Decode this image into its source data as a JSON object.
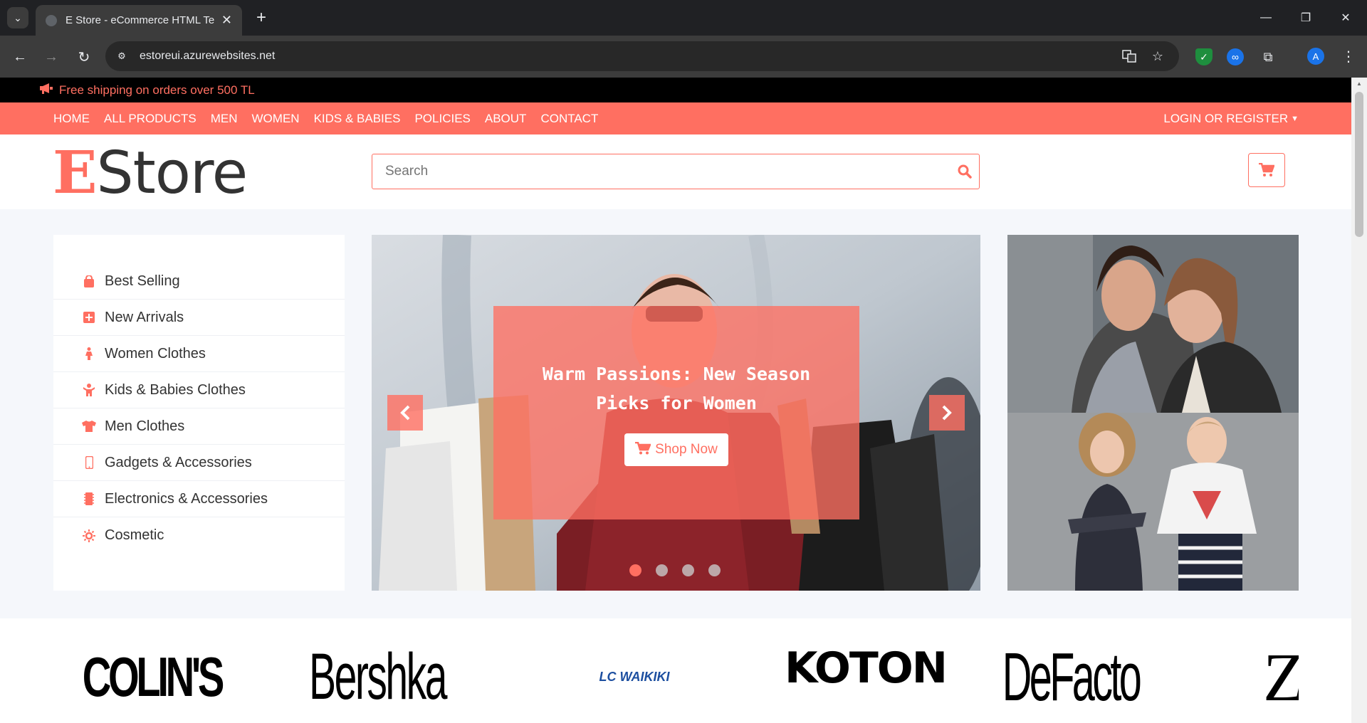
{
  "browser": {
    "tab_title": "E Store - eCommerce HTML Template",
    "url": "estoreui.azurewebsites.net",
    "profile_initial": "A"
  },
  "promo": {
    "text": "Free shipping on orders over 500 TL"
  },
  "nav": {
    "items": [
      "HOME",
      "ALL PRODUCTS",
      "MEN",
      "WOMEN",
      "KIDS & BABIES",
      "POLICIES",
      "ABOUT",
      "CONTACT"
    ],
    "login": "LOGIN OR REGISTER"
  },
  "header": {
    "logo_accent": "E",
    "logo_rest": "Store",
    "search_placeholder": "Search"
  },
  "categories": [
    {
      "label": "Best Selling",
      "icon": "shopping-bag-icon"
    },
    {
      "label": "New Arrivals",
      "icon": "plus-square-icon"
    },
    {
      "label": "Women Clothes",
      "icon": "female-icon"
    },
    {
      "label": "Kids & Babies Clothes",
      "icon": "child-icon"
    },
    {
      "label": "Men Clothes",
      "icon": "tshirt-icon"
    },
    {
      "label": "Gadgets & Accessories",
      "icon": "mobile-icon"
    },
    {
      "label": "Electronics & Accessories",
      "icon": "microchip-icon"
    },
    {
      "label": "Cosmetic",
      "icon": "sun-icon"
    }
  ],
  "slider": {
    "caption": "Warm Passions: New Season Picks for Women",
    "button": "Shop Now",
    "slide_count": 4,
    "active_slide": 0
  },
  "brands": [
    "COLIN'S",
    "Bershka",
    "LC WAIKIKI",
    "KOTON",
    "DeFacto",
    "Z"
  ],
  "colors": {
    "accent": "#ff6f61",
    "promo_bg": "#000000"
  }
}
